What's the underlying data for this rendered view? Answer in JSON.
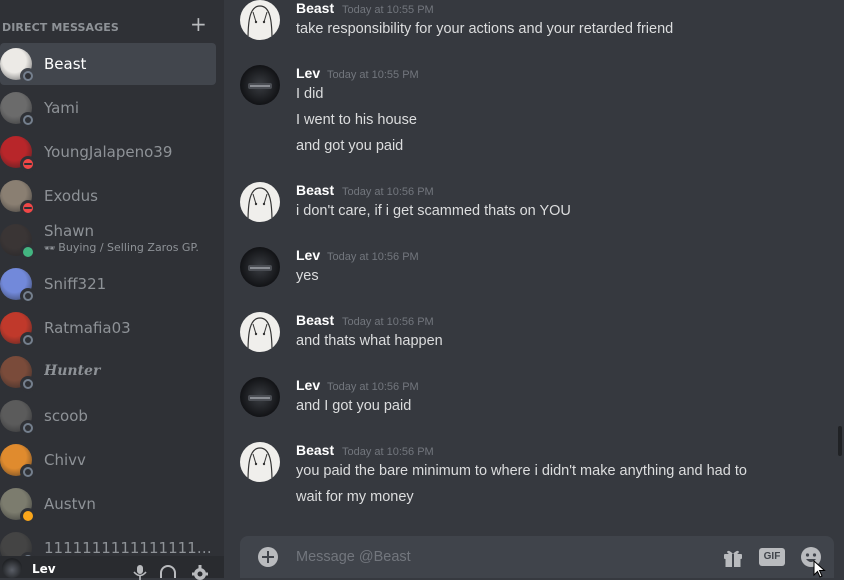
{
  "sidebar": {
    "header": "DIRECT MESSAGES",
    "add_label": "+",
    "items": [
      {
        "name": "Beast",
        "status": "offline",
        "active": true,
        "avatar_color": "#eceae6"
      },
      {
        "name": "Yami",
        "status": "offline",
        "avatar_color": "#6b6b6b"
      },
      {
        "name": "YoungJalapeno39",
        "status": "dnd",
        "avatar_color": "#b8262a"
      },
      {
        "name": "Exodus",
        "status": "dnd",
        "avatar_color": "#8a7f72"
      },
      {
        "name": "Shawn",
        "status": "online",
        "sub": "Buying / Selling Zaros GP.",
        "avatar_color": "#3a3535"
      },
      {
        "name": "Sniff321",
        "status": "offline",
        "avatar_color": "#7289da"
      },
      {
        "name": "Ratmafia03",
        "status": "offline",
        "avatar_color": "#c0392b"
      },
      {
        "name": "Hunter",
        "status": "offline",
        "italic": true,
        "avatar_color": "#7a4b3a"
      },
      {
        "name": "scoob",
        "status": "offline",
        "avatar_color": "#5b5b5b"
      },
      {
        "name": "Chivv",
        "status": "offline",
        "avatar_color": "#e08b2e"
      },
      {
        "name": "Austvn",
        "status": "idle",
        "avatar_color": "#7c7c6e"
      },
      {
        "name": "11111111111111111111111111111111",
        "status": "offline",
        "avatar_color": "#444444"
      }
    ]
  },
  "user_panel": {
    "name": "Lev"
  },
  "chat": {
    "messages": [
      {
        "author": "Beast",
        "time": "Today at 10:55 PM",
        "lines": [
          "take responsibility for your actions and your retarded friend"
        ]
      },
      {
        "author": "Lev",
        "time": "Today at 10:55 PM",
        "lines": [
          "I did",
          "I went to his house",
          "and got you paid"
        ]
      },
      {
        "author": "Beast",
        "time": "Today at 10:56 PM",
        "lines": [
          "i don't care, if i get scammed thats on YOU"
        ]
      },
      {
        "author": "Lev",
        "time": "Today at 10:56 PM",
        "lines": [
          "yes"
        ]
      },
      {
        "author": "Beast",
        "time": "Today at 10:56 PM",
        "lines": [
          "and thats what happen"
        ]
      },
      {
        "author": "Lev",
        "time": "Today at 10:56 PM",
        "lines": [
          "and I got you paid"
        ]
      },
      {
        "author": "Beast",
        "time": "Today at 10:56 PM",
        "lines": [
          "you paid the bare minimum to where i didn't make anything and had to",
          "wait for my money"
        ]
      }
    ]
  },
  "composer": {
    "placeholder": "Message @Beast",
    "gif_label": "GIF"
  },
  "icons": {
    "add": "plus-circle-icon",
    "gift": "gift-icon",
    "emoji": "emoji-icon",
    "mic": "microphone-icon",
    "headset": "headphones-icon",
    "settings": "gear-icon"
  }
}
